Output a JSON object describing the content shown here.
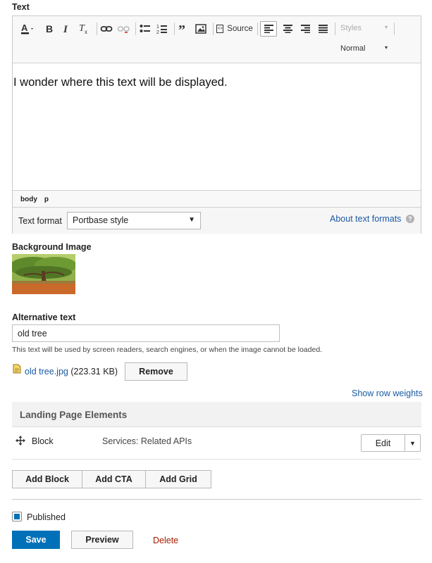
{
  "editor": {
    "label": "Text",
    "toolbar": {
      "source_label": "Source",
      "styles_label": "Styles",
      "format_label": "Normal",
      "icons": [
        "text-color-icon",
        "bold-icon",
        "italic-icon",
        "remove-format-icon",
        "link-icon",
        "unlink-icon",
        "bulleted-list-icon",
        "numbered-list-icon",
        "blockquote-icon",
        "image-icon",
        "source-icon",
        "align-left-icon",
        "align-center-icon",
        "align-right-icon",
        "justify-icon"
      ]
    },
    "content": "I wonder where this text will be displayed.",
    "path": [
      "body",
      "p"
    ],
    "text_format_label": "Text format",
    "text_format_value": "Portbase style",
    "about_formats_link": "About text formats",
    "help_icon_glyph": "?"
  },
  "background_image": {
    "label": "Background Image"
  },
  "alt_text": {
    "label": "Alternative text",
    "value": "old tree",
    "help": "This text will be used by screen readers, search engines, or when the image cannot be loaded."
  },
  "file": {
    "name": "old tree.jpg",
    "size": "(223.31 KB)",
    "remove_label": "Remove"
  },
  "show_row_weights": "Show row weights",
  "landing": {
    "header": "Landing Page Elements",
    "rows": [
      {
        "type": "Block",
        "summary": "Services: Related APIs",
        "action": "Edit"
      }
    ]
  },
  "add_buttons": [
    "Add Block",
    "Add CTA",
    "Add Grid"
  ],
  "published": {
    "label": "Published",
    "checked": true
  },
  "actions": {
    "save": "Save",
    "preview": "Preview",
    "delete": "Delete"
  },
  "colors": {
    "primary": "#0071b8",
    "link": "#1a5aa3",
    "danger": "#a51b00"
  }
}
